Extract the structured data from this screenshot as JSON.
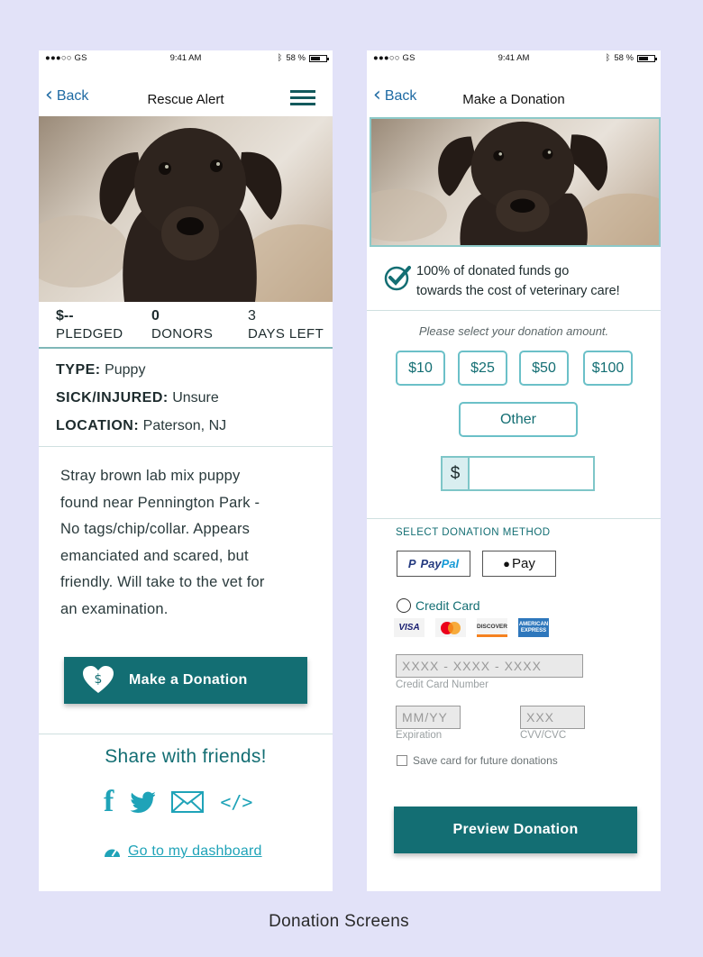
{
  "status_bar": {
    "carrier": "●●●○○ GS",
    "time": "9:41 AM",
    "battery": "58 %"
  },
  "left": {
    "back_label": "Back",
    "title": "Rescue Alert",
    "stats": [
      {
        "value": "$--",
        "label": "PLEDGED"
      },
      {
        "value": "0",
        "label": "DONORS"
      },
      {
        "value": "3",
        "label": "DAYS LEFT"
      }
    ],
    "details": [
      {
        "key": "TYPE:",
        "value": "Puppy"
      },
      {
        "key": "SICK/INJURED:",
        "value": "Unsure"
      },
      {
        "key": "LOCATION:",
        "value": "Paterson, NJ"
      }
    ],
    "description_lines": [
      "Stray brown lab mix puppy",
      "found near Pennington Park -",
      "No tags/chip/collar. Appears",
      "emanciated and scared, but",
      "friendly. Will take to the vet for",
      "an examination."
    ],
    "donate_button": "Make a Donation",
    "share_title": "Share with friends!",
    "share_icons": [
      "facebook-icon",
      "twitter-icon",
      "email-icon",
      "embed-code-icon"
    ],
    "embed_label": "</>",
    "dashboard_link": "Go to my dashboard"
  },
  "right": {
    "back_label": "Back",
    "title": "Make a Donation",
    "guarantee_lines": [
      "100% of donated funds go",
      "towards the cost of veterinary care!"
    ],
    "prompt": "Please select your donation amount.",
    "amounts": [
      "$10",
      "$25",
      "$50",
      "$100"
    ],
    "other_label": "Other",
    "currency_symbol": "$",
    "amount_value": "",
    "method_title": "SELECT DONATION METHOD",
    "paypal": {
      "part1": "Pay",
      "part2": "Pal"
    },
    "applepay_label": "Pay",
    "credit_card_label": "Credit Card",
    "card_brands": {
      "visa": "VISA",
      "discover": "DISCOVER",
      "amex": "AMERICAN EXPRESS"
    },
    "card_number": {
      "placeholder": "XXXX - XXXX - XXXX",
      "label": "Credit Card Number"
    },
    "expiration": {
      "placeholder": "MM/YY",
      "label": "Expiration"
    },
    "cvv": {
      "placeholder": "XXX",
      "label": "CVV/CVC"
    },
    "save_card_label": "Save card for future donations",
    "preview_button": "Preview Donation"
  },
  "caption": "Donation Screens",
  "colors": {
    "background": "#e2e2f8",
    "accent_teal": "#136e73",
    "link_cyan": "#1fa3b8",
    "outline_teal": "#6bc0c8",
    "ios_blue": "#1e6aa3"
  }
}
